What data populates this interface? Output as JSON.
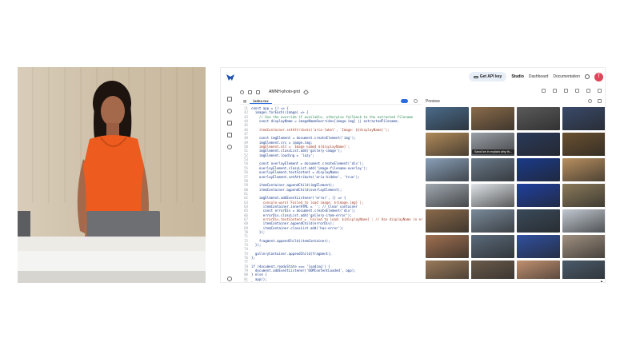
{
  "topbar": {
    "api_button": "Get API key",
    "studio": "Studio",
    "dashboard": "Dashboard",
    "documentation": "Documentation",
    "avatar_letter": "T"
  },
  "toolbar": {
    "project_name": "AMNH-photo-grid"
  },
  "editor": {
    "tab_label": "index.tsx",
    "lines": [
      {
        "n": "21",
        "t": "const app = () => {",
        "k": ""
      },
      {
        "n": "42",
        "t": "  images.forEach((image) => {",
        "k": ""
      },
      {
        "n": "43",
        "t": "    // Use the override if available, otherwise fallback to the extracted filename",
        "k": "comment"
      },
      {
        "n": "44",
        "t": "    const displayName = imageNameOverrides[image.img] || extractedFilename;",
        "k": ""
      },
      {
        "n": "45",
        "t": "",
        "k": ""
      },
      {
        "n": "46",
        "t": "    itemContainer.setAttribute('aria-label', `Image: ${displayName}`);",
        "k": "str"
      },
      {
        "n": "47",
        "t": "",
        "k": ""
      },
      {
        "n": "48",
        "t": "    const imgElement = document.createElement('img');",
        "k": ""
      },
      {
        "n": "49",
        "t": "    imgElement.src = image.img;",
        "k": ""
      },
      {
        "n": "50",
        "t": "    imgElement.alt = `Image named ${displayName}`;",
        "k": "str"
      },
      {
        "n": "51",
        "t": "    imgElement.classList.add('gallery-image');",
        "k": ""
      },
      {
        "n": "52",
        "t": "    imgElement.loading = 'lazy';",
        "k": ""
      },
      {
        "n": "53",
        "t": "",
        "k": ""
      },
      {
        "n": "54",
        "t": "    const overlayElement = document.createElement('div');",
        "k": ""
      },
      {
        "n": "55",
        "t": "    overlayElement.classList.add('image-filename-overlay');",
        "k": ""
      },
      {
        "n": "56",
        "t": "    overlayElement.textContent = displayName;",
        "k": ""
      },
      {
        "n": "57",
        "t": "    overlayElement.setAttribute('aria-hidden', 'true');",
        "k": ""
      },
      {
        "n": "58",
        "t": "",
        "k": ""
      },
      {
        "n": "59",
        "t": "    itemContainer.appendChild(imgElement);",
        "k": ""
      },
      {
        "n": "60",
        "t": "    itemContainer.appendChild(overlayElement);",
        "k": ""
      },
      {
        "n": "61",
        "t": "",
        "k": ""
      },
      {
        "n": "62",
        "t": "    imgElement.addEventListener('error', () => {",
        "k": ""
      },
      {
        "n": "63",
        "t": "      console.warn(`Failed to load image: ${image.img}`);",
        "k": "str"
      },
      {
        "n": "64",
        "t": "      itemContainer.innerHTML = ''; // Clear container",
        "k": ""
      },
      {
        "n": "65",
        "t": "      const errorDiv = document.createElement('div');",
        "k": ""
      },
      {
        "n": "66",
        "t": "      errorDiv.classList.add('gallery-item-error');",
        "k": ""
      },
      {
        "n": "67",
        "t": "      errorDiv.textContent = `Failed to load: ${displayName}`; // Use displayName in error",
        "k": "str"
      },
      {
        "n": "68",
        "t": "      itemContainer.appendChild(errorDiv);",
        "k": ""
      },
      {
        "n": "69",
        "t": "      itemContainer.classList.add('has-error');",
        "k": ""
      },
      {
        "n": "70",
        "t": "    });",
        "k": ""
      },
      {
        "n": "71",
        "t": "",
        "k": ""
      },
      {
        "n": "72",
        "t": "    fragment.appendChild(itemContainer);",
        "k": ""
      },
      {
        "n": "73",
        "t": "  });",
        "k": ""
      },
      {
        "n": "74",
        "t": "",
        "k": ""
      },
      {
        "n": "75",
        "t": "  galleryContainer.appendChild(fragment);",
        "k": ""
      },
      {
        "n": "76",
        "t": "};",
        "k": ""
      },
      {
        "n": "77",
        "t": "",
        "k": ""
      },
      {
        "n": "78",
        "t": "if (document.readyState === 'loading') {",
        "k": ""
      },
      {
        "n": "79",
        "t": "  document.addEventListener('DOMContentLoaded', app);",
        "k": ""
      },
      {
        "n": "80",
        "t": "} else {",
        "k": ""
      },
      {
        "n": "81",
        "t": "  app();",
        "k": ""
      },
      {
        "n": "82",
        "t": "}",
        "k": ""
      }
    ]
  },
  "preview": {
    "title": "Preview",
    "tooltip": "Sand ice in explain why th...",
    "tile_colors": [
      [
        "#4a6b8a",
        "#8a6b4a",
        "#5a5a5a",
        "#3a4a6a"
      ],
      [
        "#b08a5a",
        "#9aa0a8",
        "#2a3a5a",
        "#6a5030"
      ],
      [
        "#8aa0b8",
        "#6a7a8a",
        "#1a3a8a",
        "#b89060"
      ],
      [
        "#a0a8b0",
        "#e0e4e8",
        "#2040a0",
        "#8a7a5a"
      ],
      [
        "#8a6a4a",
        "#7a8a9a",
        "#3a4a5a",
        "#c0c8d0"
      ],
      [
        "#a07050",
        "#5a6a7a",
        "#3050a0",
        "#a09080"
      ],
      [
        "#9a7a5a",
        "#6a5a4a",
        "#c09070",
        "#4a5a6a"
      ]
    ]
  }
}
